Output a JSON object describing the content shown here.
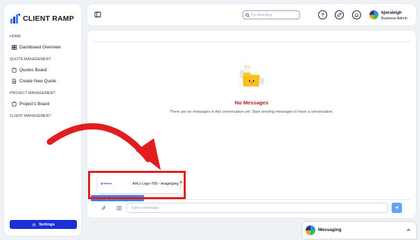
{
  "brand": {
    "name": "CLIENT RAMP"
  },
  "sidebar": {
    "sections": [
      {
        "label": "HOME"
      },
      {
        "label": "QUOTE MANAGEMENT"
      },
      {
        "label": "PROJECT MANAGEMENT"
      },
      {
        "label": "CLIENT MANAGEMENT"
      }
    ],
    "items": [
      {
        "label": "Dashboard Overview",
        "icon": "grid-icon"
      },
      {
        "label": "Quotes Board",
        "icon": "clipboard-icon"
      },
      {
        "label": "Create New Quote",
        "icon": "document-plus-icon"
      },
      {
        "label": "Project's Board",
        "icon": "clipboard-icon"
      }
    ],
    "settings_label": "Settings"
  },
  "header": {
    "search_placeholder": "Try searching",
    "user_name": "bjwraleigh",
    "user_role": "Business Admin"
  },
  "conversation": {
    "empty_title": "No Messages",
    "empty_subtitle": "There are no messages in this conversation yet. Start sending messages to have a conversation.",
    "attachment_name": "AHLI-Logo-768 - image/jpeg",
    "attachment_close": "×",
    "send_image_tip": "Send image (.PG, JPEG, PNG, GIF)",
    "compose_placeholder": "Type a message"
  },
  "dock": {
    "label": "Messaging"
  },
  "colors": {
    "accent": "#1a2fd6",
    "empty_title": "#b91c1c",
    "annotation": "#e11d1d",
    "send_button": "#60a5fa"
  }
}
